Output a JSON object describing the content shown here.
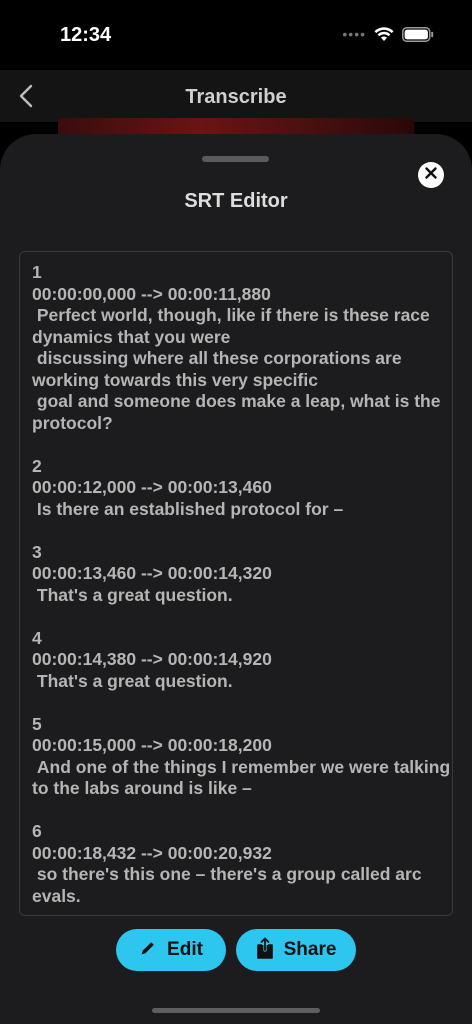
{
  "status_bar": {
    "time": "12:34",
    "signal": "••••"
  },
  "nav": {
    "title": "Transcribe",
    "back_icon": "chevron-left-icon"
  },
  "sheet": {
    "title": "SRT Editor",
    "close_icon": "close-icon",
    "entries": [
      {
        "index": "1",
        "timecode": "00:00:00,000 --> 00:00:11,880",
        "lines": [
          " Perfect world, though, like if there is these race dynamics that you were",
          " discussing where all these corporations are working towards this very specific",
          " goal and someone does make a leap, what is the protocol?"
        ]
      },
      {
        "index": "2",
        "timecode": "00:00:12,000 --> 00:00:13,460",
        "lines": [
          " Is there an established protocol for –"
        ]
      },
      {
        "index": "3",
        "timecode": "00:00:13,460 --> 00:00:14,320",
        "lines": [
          " That's a great question."
        ]
      },
      {
        "index": "4",
        "timecode": "00:00:14,380 --> 00:00:14,920",
        "lines": [
          " That's a great question."
        ]
      },
      {
        "index": "5",
        "timecode": "00:00:15,000 --> 00:00:18,200",
        "lines": [
          " And one of the things I remember we were talking to the labs around is like –"
        ]
      },
      {
        "index": "6",
        "timecode": "00:00:18,432 --> 00:00:20,932",
        "lines": [
          " so there's this one – there's a group called arc evals."
        ]
      }
    ]
  },
  "actions": {
    "edit_label": "Edit",
    "edit_icon": "pencil-icon",
    "share_label": "Share",
    "share_icon": "share-icon",
    "accent_color": "#2cc6ee"
  }
}
